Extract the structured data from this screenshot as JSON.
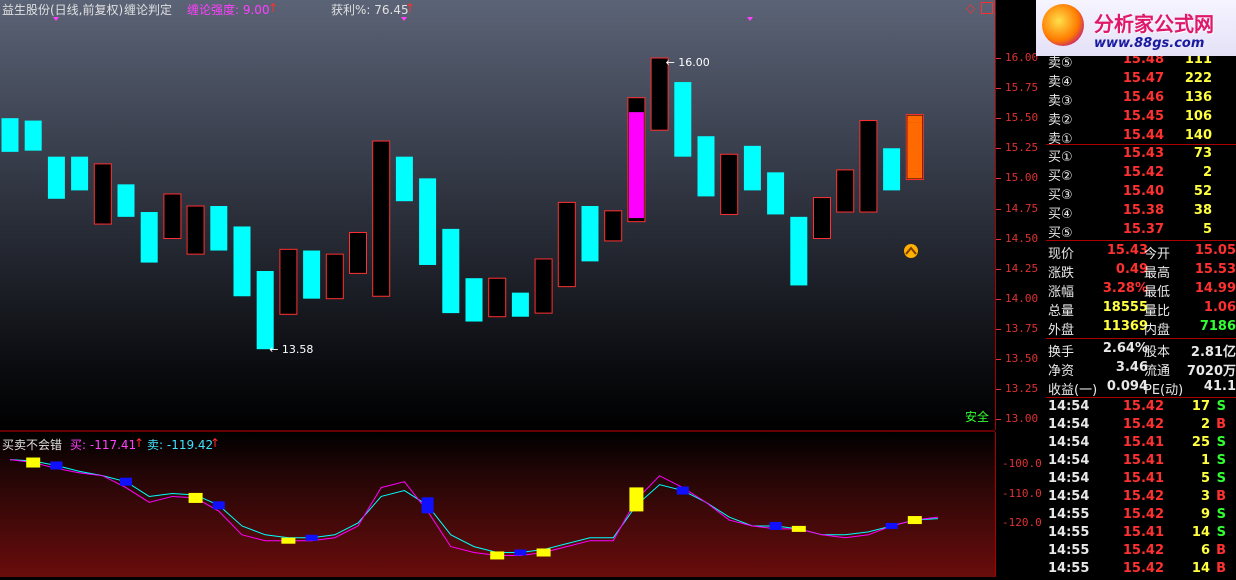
{
  "header": {
    "stock_title": "益生股份(日线,前复权)",
    "indicator_name": "缠论判定",
    "strength_label": "缠论强度: 9.00",
    "profit_label": "获利%: 76.45"
  },
  "sub_header": {
    "name": "买卖不会错",
    "buy_label": "买: -117.41",
    "sell_label": "卖: -119.42"
  },
  "safety_label": "安全",
  "max_label": "16.00",
  "min_label": "13.58",
  "price_axis": [
    "16.00",
    "15.75",
    "15.50",
    "15.25",
    "15.00",
    "14.75",
    "14.50",
    "14.25",
    "14.00",
    "13.75",
    "13.50",
    "13.25",
    "13.00"
  ],
  "sub_axis": [
    "-100.0",
    "-110.0",
    "-120.0"
  ],
  "logo": {
    "title": "分析家公式网",
    "url": "www.88gs.com"
  },
  "colors": {
    "up": "#ff3030",
    "down": "#00ffff",
    "buy_line": "#ff00ff",
    "sell_line": "#00ffff",
    "highlight": "#ff00ff",
    "current": "#ff6a00"
  },
  "order_book": {
    "sell": [
      {
        "label": "卖⑤",
        "price": "15.48",
        "vol": "111"
      },
      {
        "label": "卖④",
        "price": "15.47",
        "vol": "222"
      },
      {
        "label": "卖③",
        "price": "15.46",
        "vol": "136"
      },
      {
        "label": "卖②",
        "price": "15.45",
        "vol": "106"
      },
      {
        "label": "卖①",
        "price": "15.44",
        "vol": "140"
      }
    ],
    "buy": [
      {
        "label": "买①",
        "price": "15.43",
        "vol": "73"
      },
      {
        "label": "买②",
        "price": "15.42",
        "vol": "2"
      },
      {
        "label": "买③",
        "price": "15.40",
        "vol": "52"
      },
      {
        "label": "买④",
        "price": "15.38",
        "vol": "38"
      },
      {
        "label": "买⑤",
        "price": "15.37",
        "vol": "5"
      }
    ]
  },
  "quote": [
    {
      "l1": "现价",
      "v1": "15.43",
      "l2": "今开",
      "v2": "15.05"
    },
    {
      "l1": "涨跌",
      "v1": "0.49",
      "l2": "最高",
      "v2": "15.53"
    },
    {
      "l1": "涨幅",
      "v1": "3.28%",
      "l2": "最低",
      "v2": "14.99"
    },
    {
      "l1": "总量",
      "v1": "18555",
      "l2": "量比",
      "v2": "1.06"
    },
    {
      "l1": "外盘",
      "v1": "11369",
      "l2": "内盘",
      "v2": "7186"
    }
  ],
  "fundamentals": [
    {
      "l1": "换手",
      "v1": "2.64%",
      "l2": "股本",
      "v2": "2.81亿"
    },
    {
      "l1": "净资",
      "v1": "3.46",
      "l2": "流通",
      "v2": "7020万"
    },
    {
      "l1": "收益(一)",
      "v1": "0.094",
      "l2": "PE(动)",
      "v2": "41.1"
    }
  ],
  "ticks": [
    {
      "time": "14:54",
      "price": "15.42",
      "vol": "17",
      "side": "S"
    },
    {
      "time": "14:54",
      "price": "15.42",
      "vol": "2",
      "side": "B"
    },
    {
      "time": "14:54",
      "price": "15.41",
      "vol": "25",
      "side": "S"
    },
    {
      "time": "14:54",
      "price": "15.41",
      "vol": "1",
      "side": "S"
    },
    {
      "time": "14:54",
      "price": "15.41",
      "vol": "5",
      "side": "S"
    },
    {
      "time": "14:54",
      "price": "15.42",
      "vol": "3",
      "side": "B"
    },
    {
      "time": "14:55",
      "price": "15.42",
      "vol": "9",
      "side": "S"
    },
    {
      "time": "14:55",
      "price": "15.41",
      "vol": "14",
      "side": "S"
    },
    {
      "time": "14:55",
      "price": "15.42",
      "vol": "6",
      "side": "B"
    },
    {
      "time": "14:55",
      "price": "15.42",
      "vol": "14",
      "side": "B"
    }
  ],
  "chart_data": {
    "type": "candlestick",
    "y_range": [
      13.0,
      16.0
    ],
    "candles": [
      {
        "o": 15.5,
        "c": 15.22,
        "h": 15.5,
        "l": 15.22,
        "dir": "down"
      },
      {
        "o": 15.48,
        "c": 15.23,
        "h": 15.48,
        "l": 15.23,
        "dir": "down"
      },
      {
        "o": 15.18,
        "c": 14.83,
        "h": 15.18,
        "l": 14.83,
        "dir": "down"
      },
      {
        "o": 15.18,
        "c": 14.9,
        "h": 15.18,
        "l": 14.9,
        "dir": "down"
      },
      {
        "o": 14.62,
        "c": 15.12,
        "h": 15.12,
        "l": 14.62,
        "dir": "up"
      },
      {
        "o": 14.95,
        "c": 14.68,
        "h": 14.95,
        "l": 14.68,
        "dir": "down"
      },
      {
        "o": 14.72,
        "c": 14.3,
        "h": 14.72,
        "l": 14.3,
        "dir": "down"
      },
      {
        "o": 14.5,
        "c": 14.87,
        "h": 14.87,
        "l": 14.5,
        "dir": "up"
      },
      {
        "o": 14.37,
        "c": 14.77,
        "h": 14.77,
        "l": 14.37,
        "dir": "up"
      },
      {
        "o": 14.77,
        "c": 14.4,
        "h": 14.77,
        "l": 14.4,
        "dir": "down"
      },
      {
        "o": 14.6,
        "c": 14.02,
        "h": 14.6,
        "l": 14.02,
        "dir": "down"
      },
      {
        "o": 14.23,
        "c": 13.58,
        "h": 14.23,
        "l": 13.58,
        "dir": "down"
      },
      {
        "o": 13.87,
        "c": 14.41,
        "h": 14.41,
        "l": 13.87,
        "dir": "up"
      },
      {
        "o": 14.4,
        "c": 14.0,
        "h": 14.4,
        "l": 14.0,
        "dir": "down"
      },
      {
        "o": 14.0,
        "c": 14.37,
        "h": 14.37,
        "l": 14.0,
        "dir": "up"
      },
      {
        "o": 14.21,
        "c": 14.55,
        "h": 14.55,
        "l": 14.21,
        "dir": "up"
      },
      {
        "o": 14.02,
        "c": 15.31,
        "h": 15.31,
        "l": 14.02,
        "dir": "up"
      },
      {
        "o": 15.18,
        "c": 14.81,
        "h": 15.18,
        "l": 14.81,
        "dir": "down"
      },
      {
        "o": 15.0,
        "c": 14.28,
        "h": 15.0,
        "l": 14.28,
        "dir": "down"
      },
      {
        "o": 14.58,
        "c": 13.88,
        "h": 14.58,
        "l": 13.88,
        "dir": "down"
      },
      {
        "o": 14.17,
        "c": 13.81,
        "h": 14.17,
        "l": 13.81,
        "dir": "down"
      },
      {
        "o": 13.85,
        "c": 14.17,
        "h": 14.17,
        "l": 13.85,
        "dir": "up"
      },
      {
        "o": 14.05,
        "c": 13.85,
        "h": 14.05,
        "l": 13.85,
        "dir": "down"
      },
      {
        "o": 13.88,
        "c": 14.33,
        "h": 14.33,
        "l": 13.88,
        "dir": "up"
      },
      {
        "o": 14.1,
        "c": 14.8,
        "h": 14.8,
        "l": 14.1,
        "dir": "up"
      },
      {
        "o": 14.77,
        "c": 14.31,
        "h": 14.77,
        "l": 14.31,
        "dir": "down"
      },
      {
        "o": 14.48,
        "c": 14.73,
        "h": 14.73,
        "l": 14.48,
        "dir": "up"
      },
      {
        "o": 15.55,
        "c": 14.67,
        "h": 15.67,
        "l": 14.64,
        "dir": "highlight"
      },
      {
        "o": 15.4,
        "c": 16.0,
        "h": 16.0,
        "l": 15.4,
        "dir": "up"
      },
      {
        "o": 15.8,
        "c": 15.18,
        "h": 15.8,
        "l": 15.18,
        "dir": "down"
      },
      {
        "o": 15.35,
        "c": 14.85,
        "h": 15.35,
        "l": 14.85,
        "dir": "down"
      },
      {
        "o": 14.7,
        "c": 15.2,
        "h": 15.2,
        "l": 14.7,
        "dir": "up"
      },
      {
        "o": 15.27,
        "c": 14.9,
        "h": 15.27,
        "l": 14.9,
        "dir": "down"
      },
      {
        "o": 15.05,
        "c": 14.7,
        "h": 15.05,
        "l": 14.7,
        "dir": "down"
      },
      {
        "o": 14.68,
        "c": 14.11,
        "h": 14.68,
        "l": 14.11,
        "dir": "down"
      },
      {
        "o": 14.5,
        "c": 14.84,
        "h": 14.84,
        "l": 14.5,
        "dir": "up"
      },
      {
        "o": 14.72,
        "c": 15.07,
        "h": 15.07,
        "l": 14.72,
        "dir": "up"
      },
      {
        "o": 14.72,
        "c": 15.48,
        "h": 15.48,
        "l": 14.72,
        "dir": "up"
      },
      {
        "o": 15.25,
        "c": 14.9,
        "h": 15.25,
        "l": 14.9,
        "dir": "down"
      },
      {
        "o": 15.05,
        "c": 15.43,
        "h": 15.53,
        "l": 14.99,
        "dir": "current"
      }
    ],
    "indicator": {
      "y_range": [
        -130,
        -95
      ],
      "buy": [
        -98.5,
        -99.5,
        -101.5,
        -103,
        -104,
        -108,
        -113,
        -111,
        -111.5,
        -116,
        -124,
        -126,
        -126,
        -126,
        -125,
        -121,
        -108,
        -106,
        -116,
        -128,
        -130,
        -131,
        -131,
        -130,
        -128,
        -126,
        -126,
        -112,
        -104,
        -108,
        -113,
        -119,
        -121,
        -122,
        -122,
        -124,
        -125,
        -124,
        -121,
        -119,
        -118
      ],
      "sell": [
        -98.5,
        -99,
        -100.5,
        -102.5,
        -104,
        -106,
        -111,
        -110,
        -110.5,
        -114,
        -121,
        -124,
        -125,
        -125,
        -124,
        -120,
        -111,
        -109,
        -114,
        -124,
        -128,
        -130,
        -130,
        -129,
        -127,
        -125,
        -125,
        -114,
        -107,
        -109,
        -113,
        -118,
        -121,
        -121,
        -122,
        -124,
        -124,
        -123,
        -121,
        -119,
        -118.5
      ]
    }
  }
}
